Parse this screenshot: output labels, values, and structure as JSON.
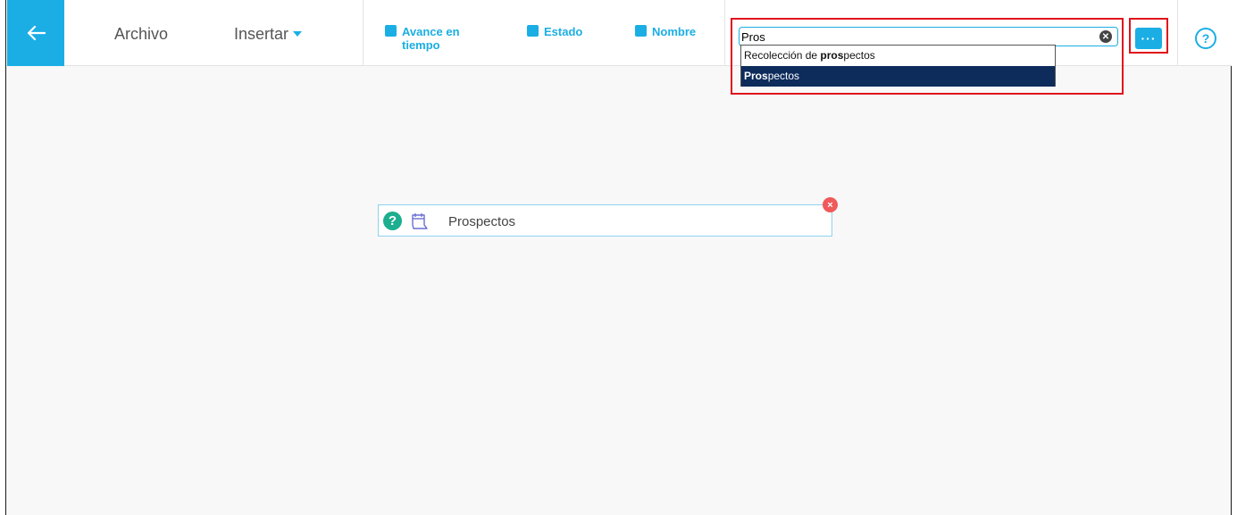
{
  "toolbar": {
    "back_icon": "arrow-left-icon",
    "archivo_label": "Archivo",
    "insertar_label": "Insertar",
    "legend": [
      {
        "line1": "Avance en",
        "line2": "tiempo"
      },
      {
        "line1": "Estado",
        "line2": ""
      },
      {
        "line1": "Nombre",
        "line2": ""
      }
    ],
    "more_label": "···",
    "help_label": "?"
  },
  "search": {
    "value": "Pros",
    "clear_icon": "x-circle-icon",
    "suggestions": [
      {
        "prefix": "Recolección de ",
        "match": "pros",
        "suffix": "pectos",
        "selected": false
      },
      {
        "prefix": "",
        "match": "Pros",
        "suffix": "pectos",
        "selected": true
      }
    ]
  },
  "canvas": {
    "node": {
      "help_label": "?",
      "icon": "calendar-icon",
      "label": "Prospectos",
      "close_label": "×"
    }
  },
  "colors": {
    "accent": "#1aaee4",
    "highlight": "#e0131b",
    "selected_bg": "#0d2c5c",
    "node_help": "#1cae8e",
    "node_close": "#f05a5a"
  }
}
